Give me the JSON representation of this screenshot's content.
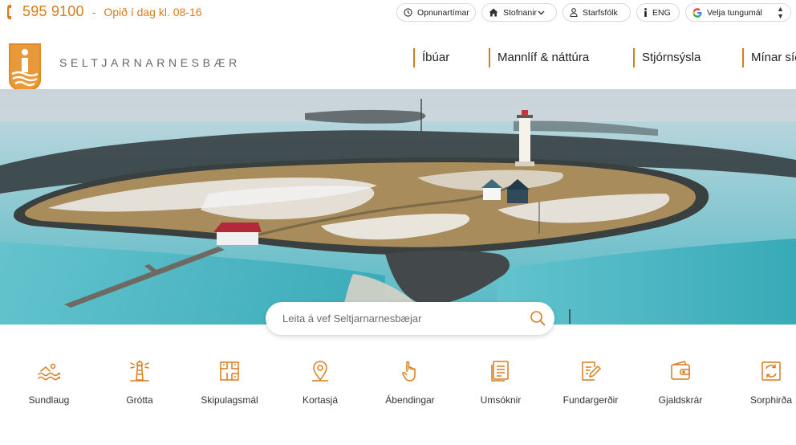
{
  "topbar": {
    "phone": "595 9100",
    "separator": "-",
    "open_hours": "Opið í dag kl. 08-16",
    "buttons": {
      "hours": "Opnunartímar",
      "institutions": "Stofnanir",
      "staff": "Starfsfólk",
      "english": "ENG",
      "language": "Velja tungumál"
    }
  },
  "header": {
    "site_name": "SELTJARNARNESBÆR",
    "nav": [
      "Íbúar",
      "Mannlíf & náttúra",
      "Stjórnsýsla",
      "Mínar síður"
    ]
  },
  "search": {
    "placeholder": "Leita á vef Seltjarnarnesbæjar"
  },
  "quick_links": [
    {
      "label": "Sundlaug",
      "icon": "swimming-icon"
    },
    {
      "label": "Grótta",
      "icon": "lighthouse-icon"
    },
    {
      "label": "Skipulagsmál",
      "icon": "floorplan-icon"
    },
    {
      "label": "Kortasjá",
      "icon": "map-pin-icon"
    },
    {
      "label": "Ábendingar",
      "icon": "pointing-hand-icon"
    },
    {
      "label": "Umsóknir",
      "icon": "documents-icon"
    },
    {
      "label": "Fundargerðir",
      "icon": "edit-document-icon"
    },
    {
      "label": "Gjaldskrár",
      "icon": "wallet-icon"
    },
    {
      "label": "Sorphirða",
      "icon": "recycle-icon"
    }
  ],
  "colors": {
    "accent": "#d97c1e",
    "text": "#333333",
    "border": "#d9d9d9"
  }
}
